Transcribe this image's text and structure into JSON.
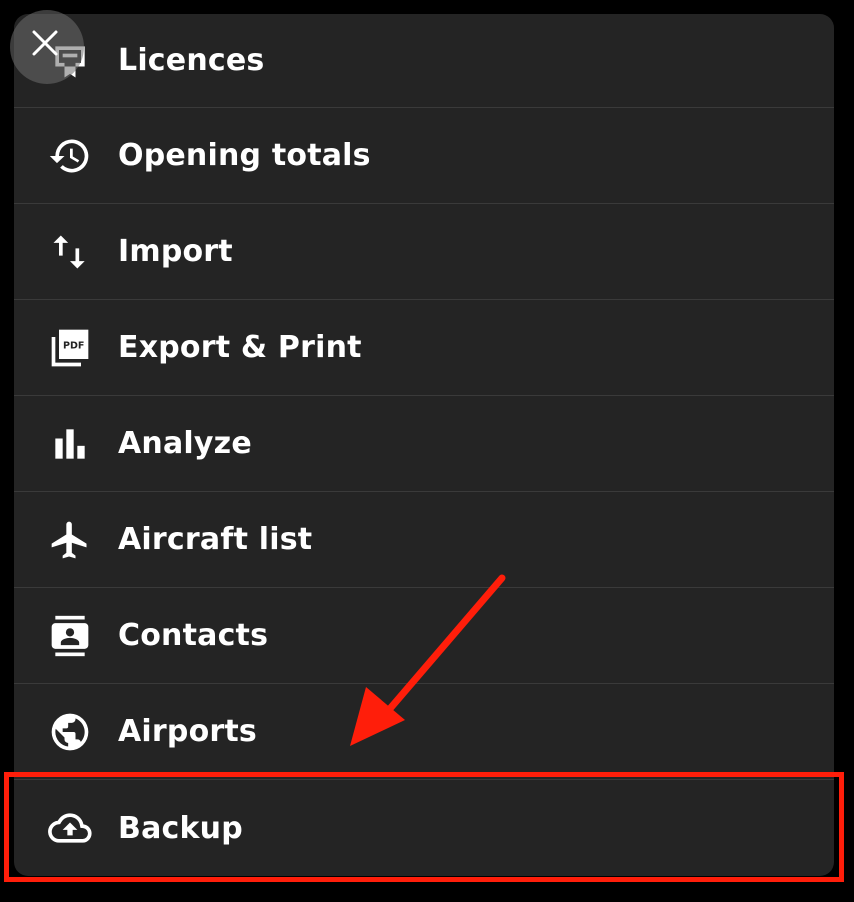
{
  "menu": {
    "items": [
      {
        "label": "Licences",
        "icon": "licence-icon"
      },
      {
        "label": "Opening totals",
        "icon": "history-icon"
      },
      {
        "label": "Import",
        "icon": "import-arrows-icon"
      },
      {
        "label": "Export & Print",
        "icon": "pdf-icon"
      },
      {
        "label": "Analyze",
        "icon": "bar-chart-icon"
      },
      {
        "label": "Aircraft list",
        "icon": "airplane-icon"
      },
      {
        "label": "Contacts",
        "icon": "contacts-icon"
      },
      {
        "label": "Airports",
        "icon": "globe-icon"
      },
      {
        "label": "Backup",
        "icon": "cloud-upload-icon"
      }
    ]
  },
  "overlay": {
    "close_icon": "close-icon",
    "highlight_color": "#ff1e0a",
    "annotation": "arrow pointing to Backup"
  },
  "colors": {
    "panel": "#242424",
    "divider": "#3a3a3a",
    "text": "#ffffff"
  }
}
